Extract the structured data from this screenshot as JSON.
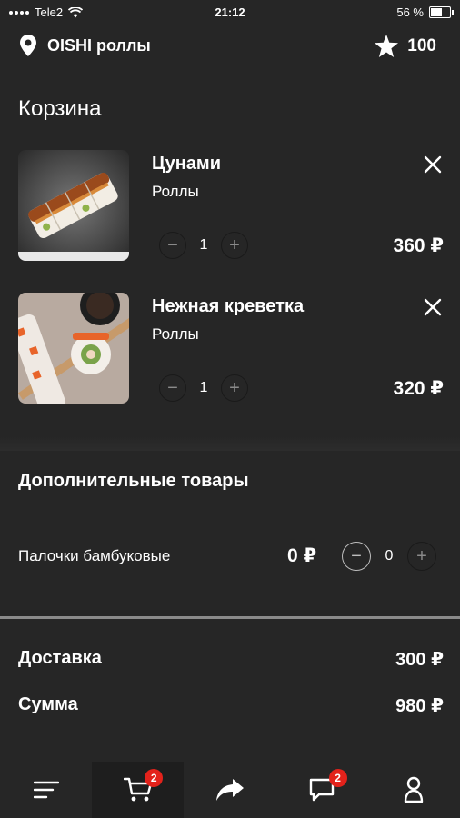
{
  "status_bar": {
    "carrier": "Tele2",
    "time": "21:12",
    "battery": "56 %",
    "battery_level": 0.56
  },
  "header": {
    "store_name": "OISHI роллы",
    "points": "100"
  },
  "page_title": "Корзина",
  "cart_items": [
    {
      "name": "Цунами",
      "category": "Роллы",
      "quantity": "1",
      "price": "360 ₽"
    },
    {
      "name": "Нежная креветка",
      "category": "Роллы",
      "quantity": "1",
      "price": "320 ₽"
    }
  ],
  "extras": {
    "title": "Дополнительные товары",
    "items": [
      {
        "name": "Палочки бамбуковые",
        "price": "0 ₽",
        "quantity": "0"
      }
    ]
  },
  "summary": {
    "delivery_label": "Доставка",
    "delivery_value": "300 ₽",
    "total_label": "Сумма",
    "total_value": "980 ₽"
  },
  "tabbar": {
    "cart_badge": "2",
    "messages_badge": "2"
  },
  "colors": {
    "background": "#262626",
    "badge": "#e3221b",
    "text": "#ffffff"
  },
  "icons": [
    "wifi-icon",
    "location-pin-icon",
    "star-icon",
    "close-icon",
    "minus-icon",
    "plus-icon",
    "menu-icon",
    "cart-icon",
    "share-icon",
    "chat-icon",
    "profile-icon"
  ]
}
